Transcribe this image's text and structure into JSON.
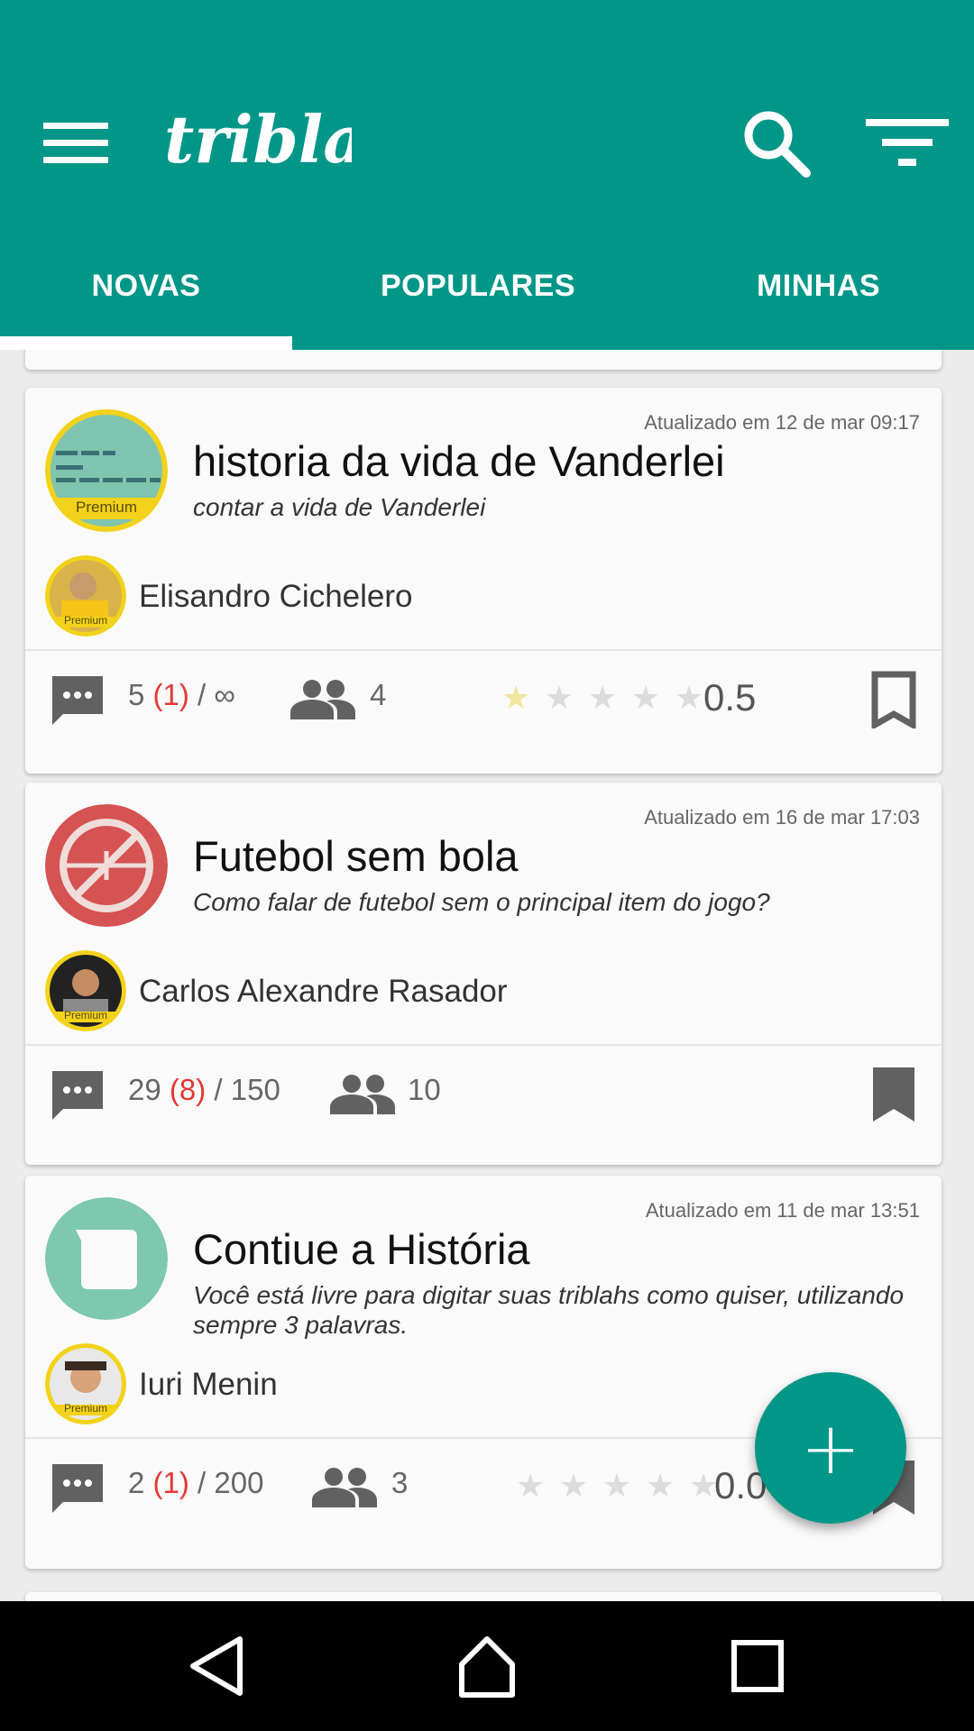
{
  "header": {
    "logo_text": "triblah",
    "brand_color": "#009688",
    "icons": [
      "hamburger-menu-icon",
      "search-icon",
      "filter-icon"
    ]
  },
  "tabs": [
    {
      "label": "NOVAS",
      "active": true
    },
    {
      "label": "POPULARES",
      "active": false
    },
    {
      "label": "MINHAS",
      "active": false
    }
  ],
  "cards": [
    {
      "updated": "Atualizado em 12 de mar 09:17",
      "title": "historia da vida de Vanderlei",
      "description": "contar a vida de Vanderlei",
      "topic_badge": "Premium",
      "author": "Elisandro Cichelero",
      "author_badge": "Premium",
      "messages": "5",
      "messages_new": "(1)",
      "messages_limit": "/ ∞",
      "participants": "4",
      "rating": "0.5",
      "stars_filled": 0.5
    },
    {
      "updated": "Atualizado em 16 de mar 17:03",
      "title": "Futebol sem bola",
      "description": "Como falar de futebol sem o principal item do jogo?",
      "author": "Carlos Alexandre Rasador",
      "author_badge": "Premium",
      "messages": "29",
      "messages_new": "(8)",
      "messages_limit": "/ 150",
      "participants": "10"
    },
    {
      "updated": "Atualizado em 11 de mar 13:51",
      "title": "Contiue a História",
      "description": "Você está livre para digitar suas triblahs como quiser, utilizando sempre 3 palavras.",
      "author": "Iuri Menin",
      "author_badge": "Premium",
      "messages": "2",
      "messages_new": "(1)",
      "messages_limit": "/ 200",
      "participants": "3",
      "rating": "0.0",
      "stars_filled": 0
    }
  ],
  "fab": {
    "icon": "plus-icon",
    "label": "+"
  },
  "navbar": {
    "icons": [
      "back-icon",
      "home-icon",
      "recents-icon"
    ]
  }
}
